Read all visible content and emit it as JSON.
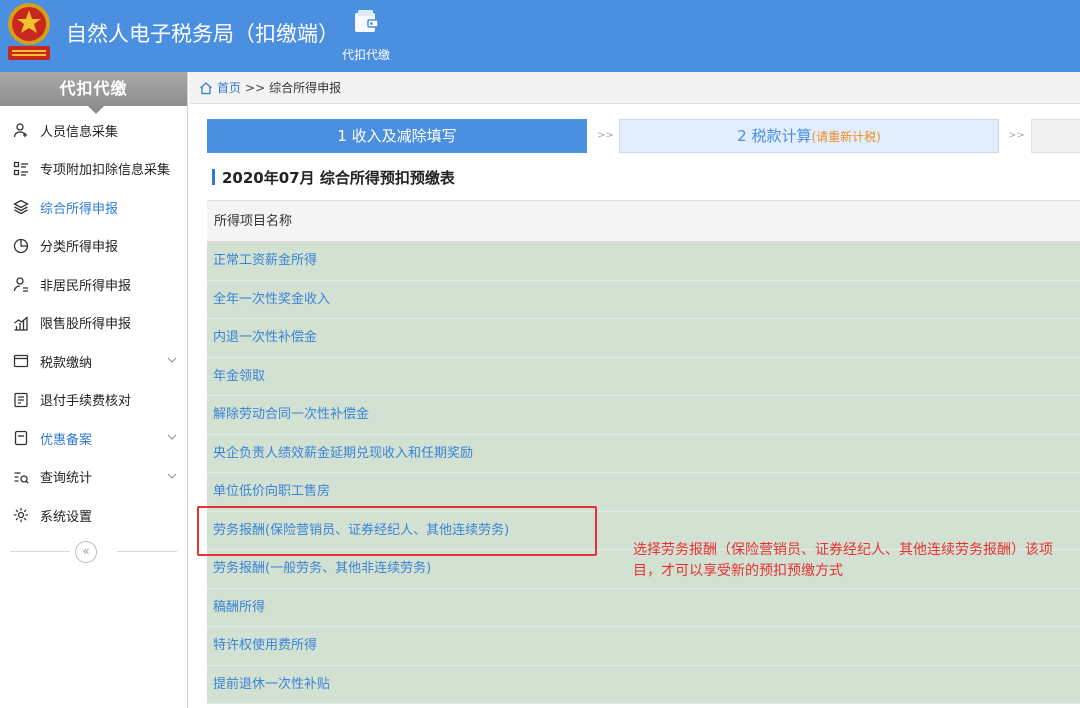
{
  "header": {
    "app_title": "自然人电子税务局（扣缴端）",
    "nav_tool_label": "代扣代缴"
  },
  "sidebar": {
    "title": "代扣代缴",
    "items": [
      {
        "label": "人员信息采集",
        "icon": "person-add-icon"
      },
      {
        "label": "专项附加扣除信息采集",
        "icon": "list-icon"
      },
      {
        "label": "综合所得申报",
        "icon": "layers-icon",
        "active": true
      },
      {
        "label": "分类所得申报",
        "icon": "pie-chart-icon"
      },
      {
        "label": "非居民所得申报",
        "icon": "person-icon"
      },
      {
        "label": "限售股所得申报",
        "icon": "stock-chart-icon"
      },
      {
        "label": "税款缴纳",
        "icon": "window-icon",
        "expandable": true
      },
      {
        "label": "退付手续费核对",
        "icon": "document-check-icon"
      },
      {
        "label": "优惠备案",
        "icon": "document-icon",
        "expandable": true
      },
      {
        "label": "查询统计",
        "icon": "search-list-icon",
        "expandable": true
      },
      {
        "label": "系统设置",
        "icon": "gear-icon"
      }
    ],
    "collapse_glyph": "«"
  },
  "breadcrumb": {
    "home": "首页",
    "separator": ">>",
    "current": "综合所得申报"
  },
  "steps": {
    "step1": "1 收入及减除填写",
    "separator": ">>",
    "step2": "2 税款计算",
    "step2_hint": "(请重新计税)"
  },
  "table": {
    "title": "2020年07月  综合所得预扣预缴表",
    "header": "所得项目名称",
    "rows": [
      "正常工资薪金所得",
      "全年一次性奖金收入",
      "内退一次性补偿金",
      "年金领取",
      "解除劳动合同一次性补偿金",
      "央企负责人绩效薪金延期兑现收入和任期奖励",
      "单位低价向职工售房",
      "劳务报酬(保险营销员、证券经纪人、其他连续劳务)",
      "劳务报酬(一般劳务、其他非连续劳务)",
      "稿酬所得",
      "特许权使用费所得",
      "提前退休一次性补贴"
    ]
  },
  "annotation": {
    "text": "选择劳务报酬（保险营销员、证券经纪人、其他连续劳务报酬）该项目，才可以享受新的预扣预缴方式"
  },
  "colors": {
    "header_blue": "#4a8fe0",
    "link_blue": "#3a84d4",
    "row_green": "#d3e1d3",
    "annotation_red": "#e53333",
    "hint_orange": "#f08c22"
  }
}
